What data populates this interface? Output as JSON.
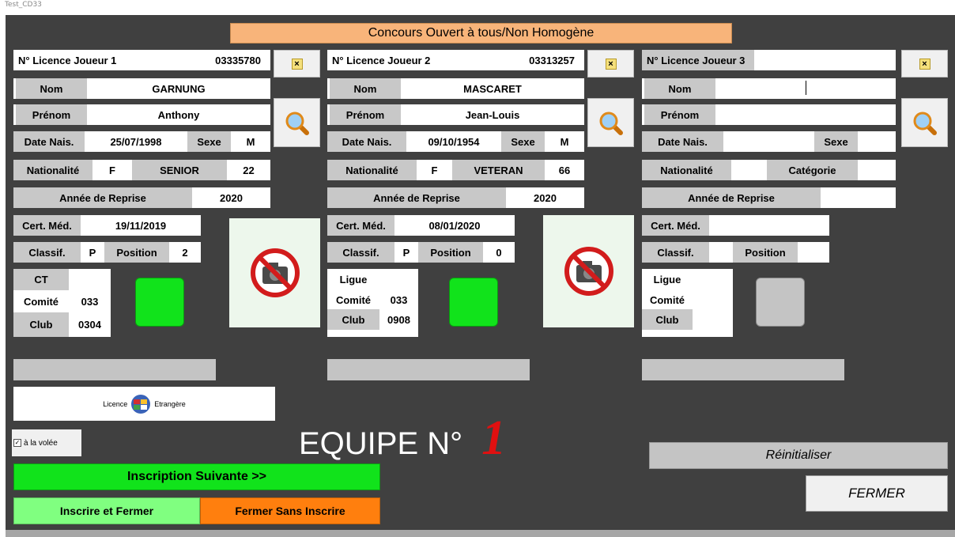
{
  "window": {
    "title": "Test_CD33"
  },
  "banner": "Concours Ouvert à tous/Non Homogène",
  "common": {
    "nom": "Nom",
    "prenom": "Prénom",
    "date_nais": "Date Nais.",
    "sexe": "Sexe",
    "nationalite": "Nationalité",
    "annee_reprise": "Année de Reprise",
    "cert_med": "Cert. Méd.",
    "classif": "Classif.",
    "position": "Position",
    "ct": "CT",
    "ligue": "Ligue",
    "comite": "Comité",
    "club": "Club",
    "categorie": "Catégorie",
    "clear_glyph": "×"
  },
  "players": [
    {
      "licence_label": "N° Licence Joueur 1",
      "licence": "03335780",
      "nom": "GARNUNG",
      "prenom": "Anthony",
      "date_nais": "25/07/1998",
      "sexe": "M",
      "nationalite": "F",
      "categorie": "SENIOR",
      "age": "22",
      "annee_reprise": "2020",
      "cert_med": "19/11/2019",
      "classif": "P",
      "position": "2",
      "ct": "",
      "comite": "033",
      "club": "0304",
      "status_color": "#11e31b"
    },
    {
      "licence_label": "N° Licence Joueur 2",
      "licence": "03313257",
      "nom": "MASCARET",
      "prenom": "Jean-Louis",
      "date_nais": "09/10/1954",
      "sexe": "M",
      "nationalite": "F",
      "categorie": "VETERAN",
      "age": "66",
      "annee_reprise": "2020",
      "cert_med": "08/01/2020",
      "classif": "P",
      "position": "0",
      "ligue": "",
      "comite": "033",
      "club": "0908",
      "status_color": "#11e31b"
    },
    {
      "licence_label": "N° Licence Joueur 3",
      "licence": "",
      "nom": "",
      "prenom": "",
      "date_nais": "",
      "sexe": "",
      "nationalite": "",
      "categorie_label": "Catégorie",
      "age": "",
      "annee_reprise": "",
      "cert_med": "",
      "classif": "",
      "position": "",
      "ligue": "",
      "comite": "",
      "club": "",
      "status_color": "#c4c4c4"
    }
  ],
  "foreign_licence": {
    "left": "Licence",
    "right": "Etrangère"
  },
  "a_la_volee": {
    "label": "à la volée",
    "checked": true
  },
  "equipe": {
    "label": "EQUIPE N°",
    "number": "1"
  },
  "buttons": {
    "inscription_suivante": "Inscription Suivante >>",
    "inscrire_fermer": "Inscrire et Fermer",
    "fermer_sans_inscrire": "Fermer Sans Inscrire",
    "reinitialiser": "Réinitialiser",
    "fermer": "FERMER"
  },
  "colors": {
    "panel": "#404040",
    "banner": "#f8b47a",
    "green": "#11e31b",
    "light_green": "#80ff80",
    "orange": "#ff7f0e",
    "red": "#e01010"
  }
}
